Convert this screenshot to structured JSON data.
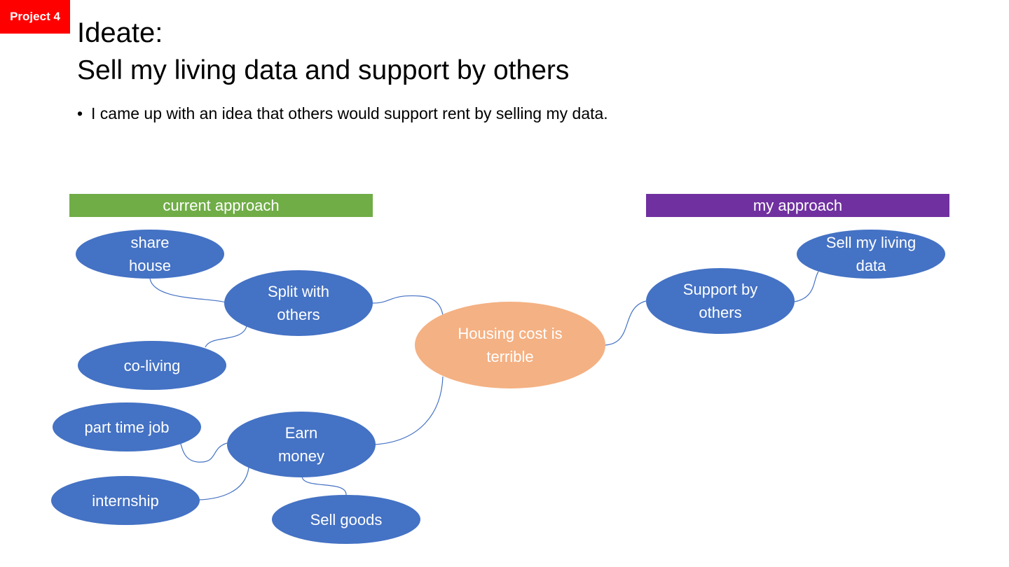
{
  "slide": {
    "tag": "Project 4",
    "title_line1": "Ideate:",
    "title_line2": "Sell my living data and support by others",
    "bullet": "I came up with an idea that others would support rent by selling my data."
  },
  "bands": {
    "current": "current approach",
    "mine": "my approach"
  },
  "colors": {
    "tag": "#ff0000",
    "band_current": "#70ad47",
    "band_mine": "#7030a0",
    "node": "#4472c4",
    "center_node": "#f4b183",
    "link": "#4472c4"
  },
  "nodes": {
    "center": "Housing cost is terrible",
    "split": "Split with others",
    "share_house": "share house",
    "co_living": "co-living",
    "earn_money": "Earn money",
    "part_time": "part time job",
    "internship": "internship",
    "sell_goods": "Sell goods",
    "support": "Support by others",
    "sell_data": "Sell my living data"
  }
}
